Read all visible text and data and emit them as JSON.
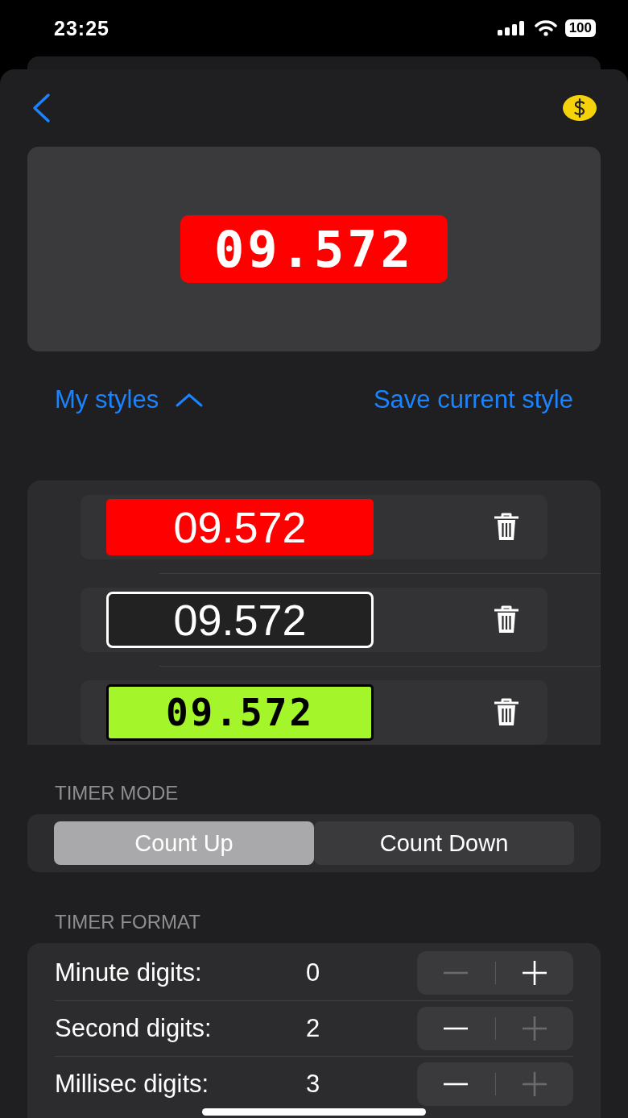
{
  "status_bar": {
    "time": "23:25",
    "battery": "100"
  },
  "preview": {
    "time": "09.572"
  },
  "links": {
    "my_styles": "My styles",
    "my_styles_expanded": true,
    "save": "Save current style"
  },
  "styles": [
    {
      "kind": "red",
      "time": "09.572"
    },
    {
      "kind": "outline",
      "time": "09.572"
    },
    {
      "kind": "lcd",
      "time": "09.572"
    }
  ],
  "timer_mode": {
    "label": "TIMER MODE",
    "options": [
      {
        "label": "Count Up",
        "selected": true
      },
      {
        "label": "Count Down",
        "selected": false
      }
    ]
  },
  "timer_format": {
    "label": "TIMER FORMAT",
    "rows": [
      {
        "label": "Minute digits:",
        "value": "0",
        "minus_disabled": true,
        "plus_disabled": false
      },
      {
        "label": "Second digits:",
        "value": "2",
        "minus_disabled": false,
        "plus_disabled": true
      },
      {
        "label": "Millisec digits:",
        "value": "3",
        "minus_disabled": false,
        "plus_disabled": true
      }
    ]
  }
}
